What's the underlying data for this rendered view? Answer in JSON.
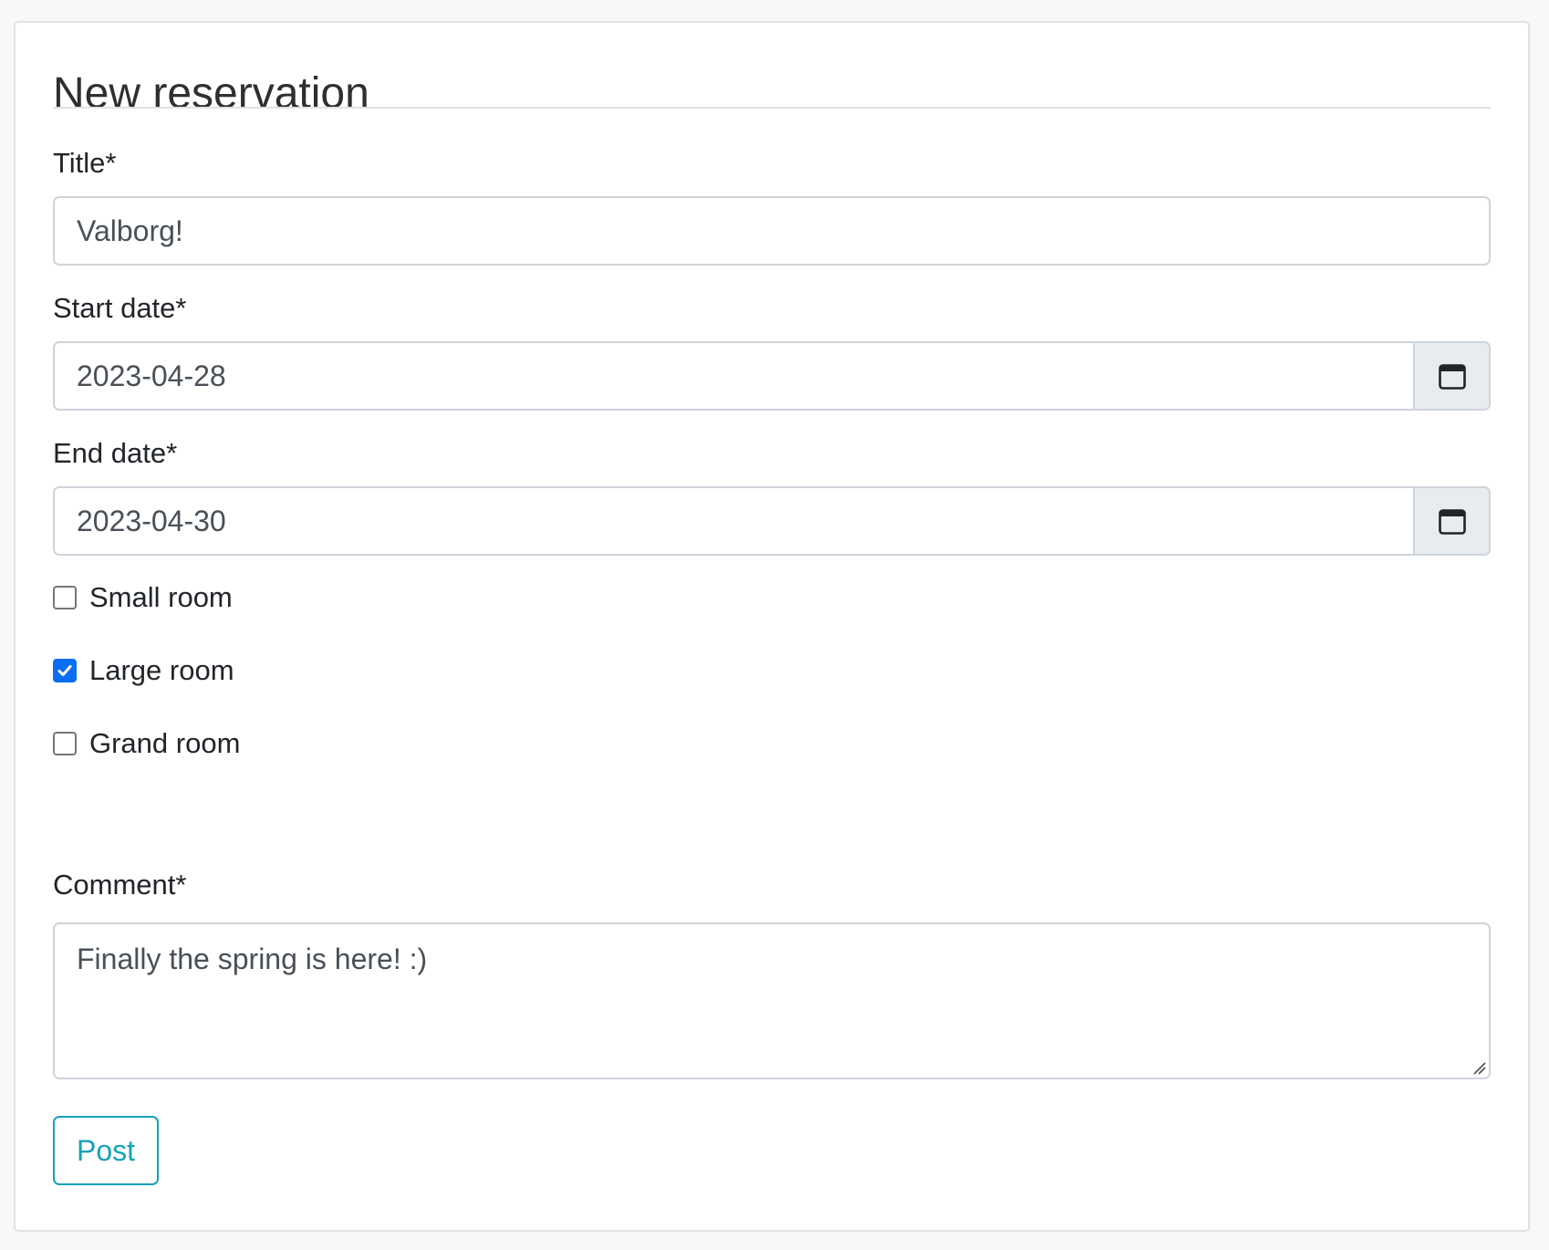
{
  "form": {
    "heading": "New reservation",
    "title": {
      "label": "Title*",
      "value": "Valborg!"
    },
    "start_date": {
      "label": "Start date*",
      "value": "2023-04-28",
      "icon": "calendar-icon"
    },
    "end_date": {
      "label": "End date*",
      "value": "2023-04-30",
      "icon": "calendar-icon"
    },
    "rooms": [
      {
        "label": "Small room",
        "checked": false
      },
      {
        "label": "Large room",
        "checked": true
      },
      {
        "label": "Grand room",
        "checked": false
      }
    ],
    "comment": {
      "label": "Comment*",
      "value": "Finally the spring is here! :)"
    },
    "submit_label": "Post"
  },
  "colors": {
    "accent": "#17a2b8",
    "checkbox_checked": "#0b6ef2",
    "addon_background": "#e9ecef",
    "border": "#ced4da"
  }
}
